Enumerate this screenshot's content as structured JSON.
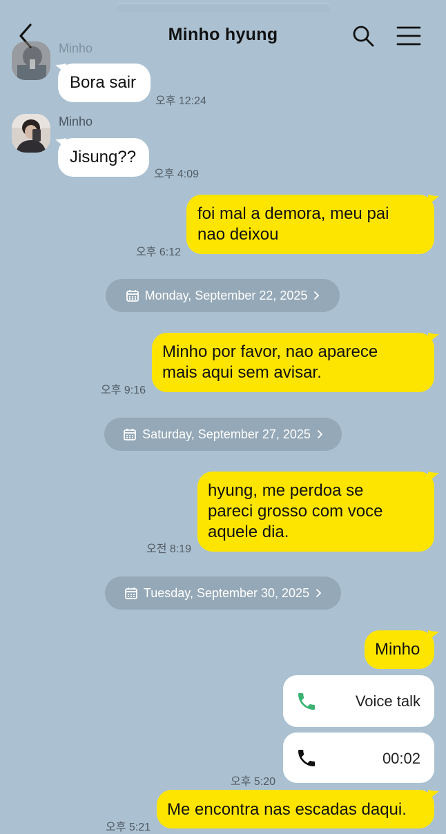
{
  "header": {
    "title": "Minho hyung",
    "back_icon": "chevron-left-icon",
    "search_icon": "search-icon",
    "menu_icon": "hamburger-menu-icon"
  },
  "colors": {
    "background": "#abc1d1",
    "outgoing_bubble": "#fee500",
    "incoming_bubble": "#ffffff",
    "date_pill": "#94a8b7",
    "voice_call_icon": "#3bb273"
  },
  "messages": [
    {
      "sender": "Minho",
      "text": "Bora sair",
      "time": "오후 12:24"
    },
    {
      "sender": "Minho",
      "text": "Jisung??",
      "time": "오후 4:09"
    },
    {
      "sender": "me",
      "text": "foi mal a demora, meu pai\nnao deixou",
      "time": "오후 6:12"
    },
    {
      "date": "Monday, September 22, 2025"
    },
    {
      "sender": "me",
      "text": "Minho por favor, nao aparece\nmais aqui sem avisar.",
      "time": "오후 9:16"
    },
    {
      "date": "Saturday, September 27, 2025"
    },
    {
      "sender": "me",
      "text": "hyung, me perdoa se\npareci grosso com voce\naquele dia.",
      "time": "오전 8:19"
    },
    {
      "date": "Tuesday, September 30, 2025"
    },
    {
      "sender": "me",
      "text": "Minho"
    },
    {
      "sender": "me",
      "call": "Voice talk"
    },
    {
      "sender": "me",
      "call": "00:02",
      "time": "오후 5:20"
    },
    {
      "sender": "me",
      "text": "Me encontra nas escadas daqui.",
      "time": "오후 5:21"
    }
  ]
}
